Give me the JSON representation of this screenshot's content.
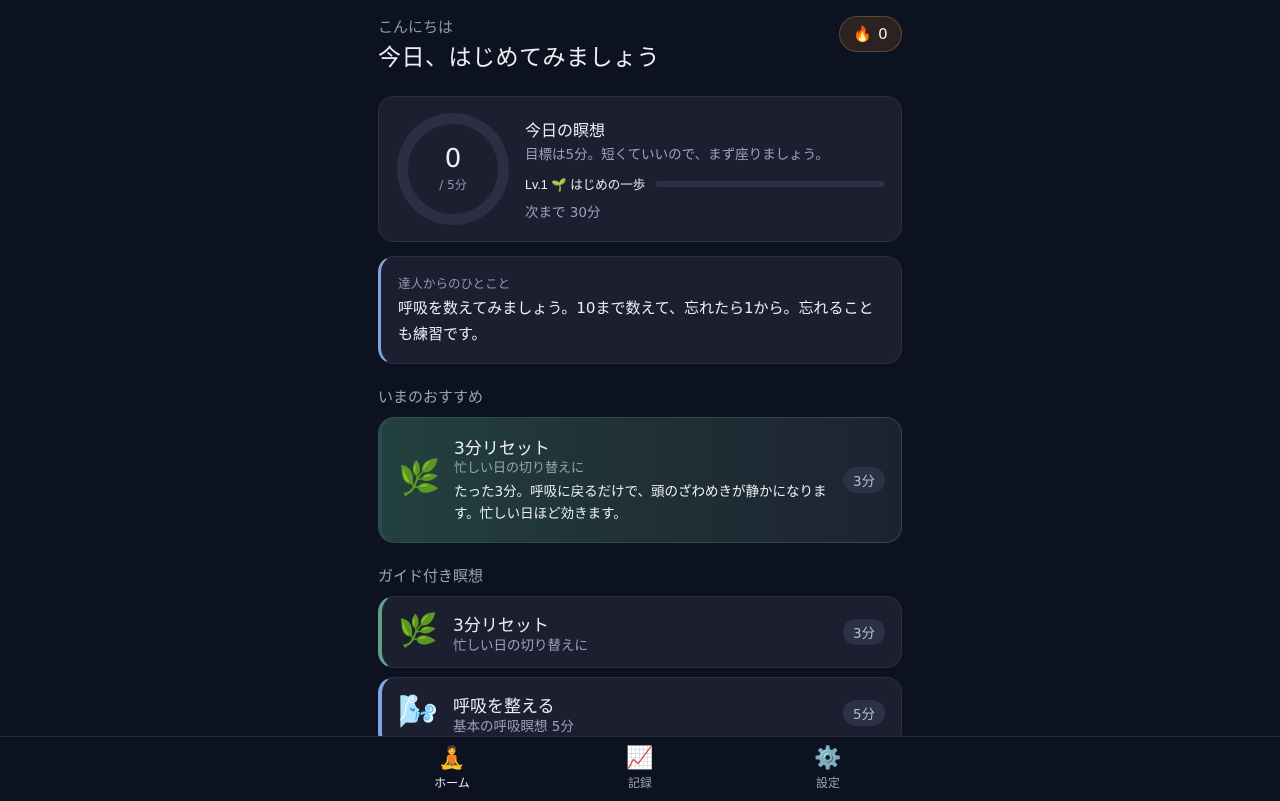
{
  "header": {
    "greeting": "こんにちは",
    "headline": "今日、はじめてみましょう",
    "streak_icon": "fire-icon",
    "streak_count": "0"
  },
  "today": {
    "minutes_done": "0",
    "goal_label": "/ 5分",
    "title": "今日の瞑想",
    "subtitle": "目標は5分。短くていいので、まず座りましょう。",
    "level_label": "Lv.1 🌱 はじめの一歩",
    "level_progress": 0,
    "next_label": "次まで 30分"
  },
  "advice": {
    "label": "達人からのひとこと",
    "text": "呼吸を数えてみましょう。10まで数えて、忘れたら1から。忘れることも練習です。"
  },
  "recommend": {
    "section_title": "いまのおすすめ",
    "icon": "🌿",
    "title": "3分リセット",
    "subtitle": "忙しい日の切り替えに",
    "description": "たった3分。呼吸に戻るだけで、頭のざわめきが静かになります。忙しい日ほど効きます。",
    "duration": "3分"
  },
  "guided": {
    "section_title": "ガイド付き瞑想",
    "items": [
      {
        "icon": "🌿",
        "title": "3分リセット",
        "subtitle": "忙しい日の切り替えに",
        "duration": "3分"
      },
      {
        "icon": "🌬️",
        "title": "呼吸を整える",
        "subtitle": "基本の呼吸瞑想 5分",
        "duration": "5分"
      }
    ]
  },
  "nav": {
    "items": [
      {
        "icon": "🧘",
        "label": "ホーム"
      },
      {
        "icon": "📈",
        "label": "記録"
      },
      {
        "icon": "⚙️",
        "label": "設定"
      }
    ]
  }
}
